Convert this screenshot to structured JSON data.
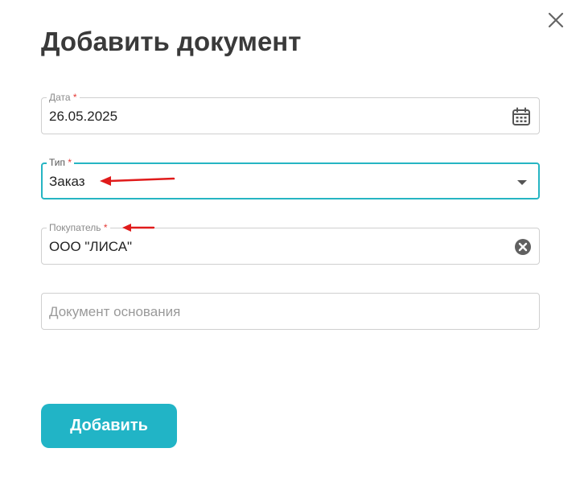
{
  "dialog": {
    "title": "Добавить документ",
    "close_icon": "close-icon"
  },
  "fields": {
    "date": {
      "label": "Дата",
      "required_mark": "*",
      "value": "26.05.2025",
      "icon": "calendar-icon"
    },
    "type": {
      "label": "Тип",
      "required_mark": "*",
      "value": "Заказ",
      "icon": "caret-down-icon"
    },
    "buyer": {
      "label": "Покупатель",
      "required_mark": "*",
      "value": "ООО \"ЛИСА\"",
      "icon": "clear-circle-icon"
    },
    "base_document": {
      "placeholder": "Документ основания"
    }
  },
  "actions": {
    "submit_label": "Добавить"
  },
  "colors": {
    "accent": "#21b4c6",
    "focus_border": "#26b5c3",
    "required": "#e53935",
    "annotation_arrow": "#e01b1b",
    "title": "#3a3a3a"
  }
}
